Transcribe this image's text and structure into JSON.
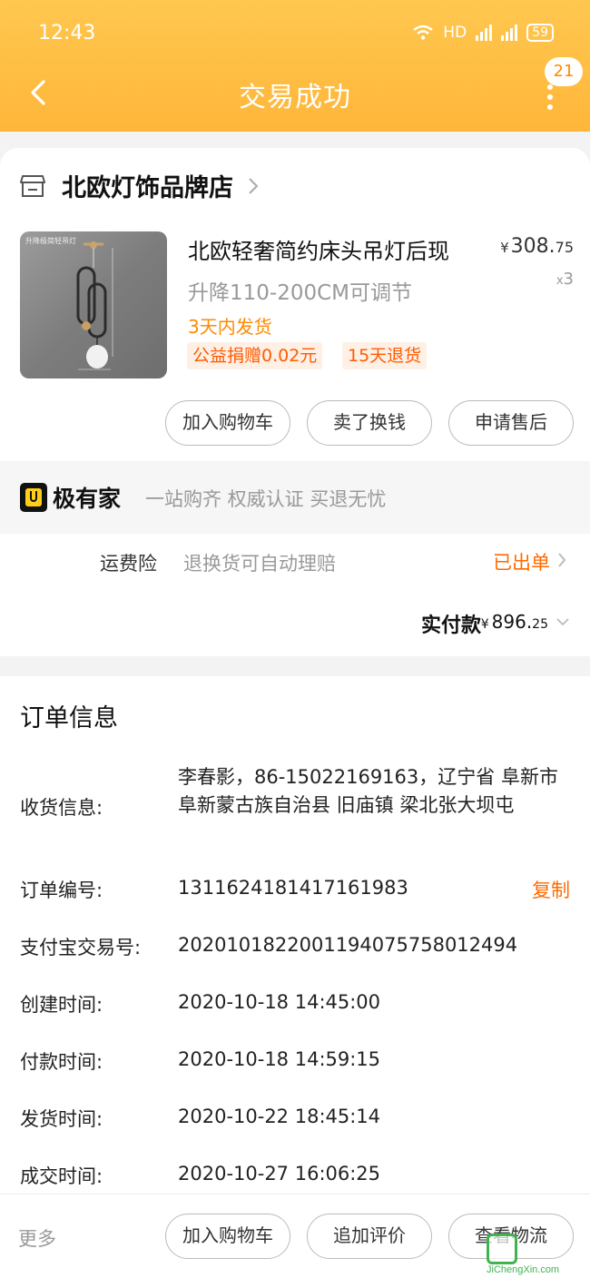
{
  "status_bar": {
    "time": "12:43",
    "network": "HD",
    "battery": "59"
  },
  "header": {
    "title": "交易成功",
    "badge_count": "21"
  },
  "shop": {
    "name": "北欧灯饰品牌店"
  },
  "product": {
    "title": "北欧轻奢简约床头吊灯后现",
    "spec": "升降110-200CM可调节",
    "shipping": "3天内发货",
    "tags": [
      "公益捐赠0.02元",
      "15天退货"
    ],
    "price_symbol": "¥",
    "price_int": "308.",
    "price_dec": "75",
    "qty_x": "x",
    "qty": "3",
    "image_caption": "升降极简轻吊灯"
  },
  "actions": {
    "add_cart": "加入购物车",
    "sell": "卖了换钱",
    "after_sale": "申请售后"
  },
  "jiyoujia": {
    "name": "极有家",
    "slogan": "一站购齐 权威认证 买退无忧"
  },
  "insurance": {
    "label": "运费险",
    "desc": "退换货可自动理赔",
    "status": "已出单"
  },
  "payment": {
    "label": "实付款",
    "symbol": "¥",
    "amount_int": "896.",
    "amount_dec": "25"
  },
  "order": {
    "title": "订单信息",
    "address_label": "收货信息:",
    "address": "李春影，86-15022169163，辽宁省 阜新市 阜新蒙古族自治县 旧庙镇 梁北张大坝屯",
    "rows": [
      {
        "label": "订单编号:",
        "value": "1311624181417161983"
      },
      {
        "label": "支付宝交易号:",
        "value": "2020101822001194075758012494"
      },
      {
        "label": "创建时间:",
        "value": "2020-10-18 14:45:00"
      },
      {
        "label": "付款时间:",
        "value": "2020-10-18 14:59:15"
      },
      {
        "label": "发货时间:",
        "value": "2020-10-22 18:45:14"
      },
      {
        "label": "成交时间:",
        "value": "2020-10-27 16:06:25"
      }
    ],
    "copy_label": "复制"
  },
  "bottom": {
    "more": "更多",
    "add_cart": "加入购物车",
    "review": "追加评价",
    "logistics": "查看物流"
  },
  "watermark": {
    "text": "JiChengXin.com"
  },
  "colors": {
    "header": "#ffb63a",
    "accent": "#ff6a00",
    "tag_bg": "#fff0e6"
  }
}
